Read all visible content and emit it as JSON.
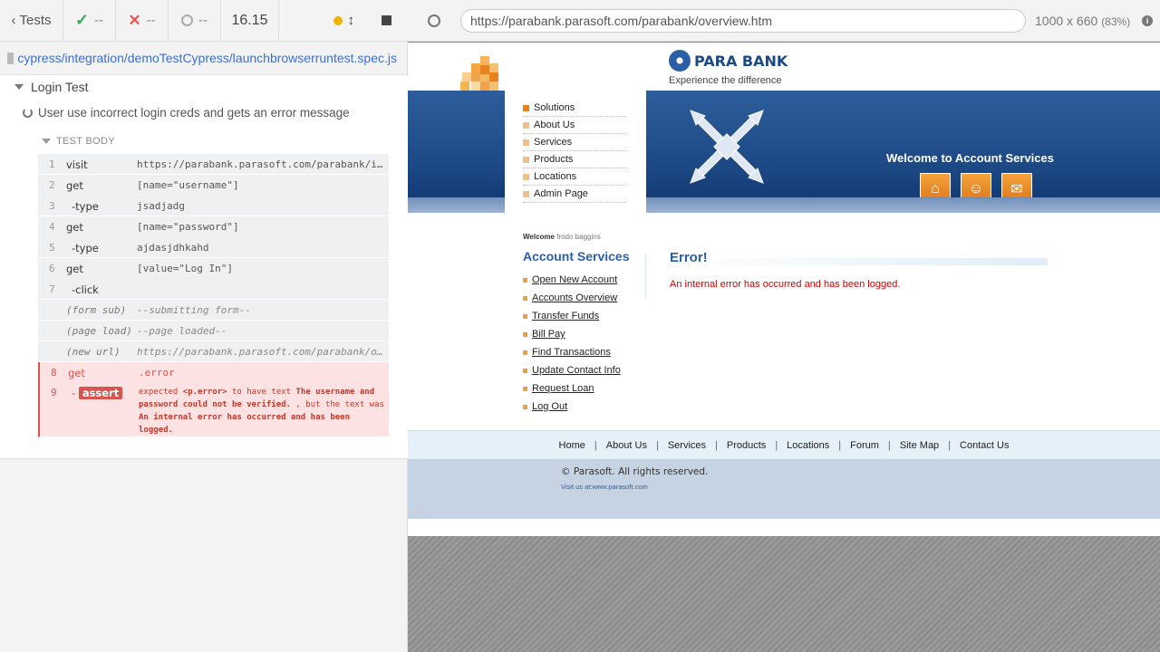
{
  "runner": {
    "tests_label": "Tests",
    "passed": "--",
    "failed": "--",
    "pending": "--",
    "duration": "16.15"
  },
  "spec": {
    "path": "cypress/integration/demoTestCypress/launchbrowserruntest.spec.js"
  },
  "suite": {
    "title": "Login Test",
    "test_title": "User use incorrect login creds and gets an error message",
    "body_label": "TEST BODY"
  },
  "commands": [
    {
      "num": "1",
      "name": "visit",
      "msg": "https://parabank.parasoft.com/parabank/index.htm"
    },
    {
      "num": "2",
      "name": "get",
      "msg": "[name=\"username\"]"
    },
    {
      "num": "3",
      "name": "-type",
      "msg": "jsadjadg"
    },
    {
      "num": "4",
      "name": "get",
      "msg": "[name=\"password\"]"
    },
    {
      "num": "5",
      "name": "-type",
      "msg": "ajdasjdhkahd"
    },
    {
      "num": "6",
      "name": "get",
      "msg": "[value=\"Log In\"]"
    },
    {
      "num": "7",
      "name": "-click",
      "msg": ""
    },
    {
      "num": "",
      "name": "(form sub)",
      "msg": "--submitting form--"
    },
    {
      "num": "",
      "name": "(page load)",
      "msg": "--page loaded--"
    },
    {
      "num": "",
      "name": "(new url)",
      "msg": "https://parabank.parasoft.com/parabank/overview.htm"
    },
    {
      "num": "8",
      "name": "get",
      "msg": ".error"
    }
  ],
  "assert": {
    "num": "9",
    "dash": "-",
    "label": "assert",
    "expected": "expected",
    "selector": "<p.error>",
    "to_have_text": "to have text",
    "expected_text": "The username and password could not be verified.",
    "but_the_text_was": ", but the text was",
    "actual_text": "An internal error has occurred and has been logged."
  },
  "browser": {
    "url": "https://parabank.parasoft.com/parabank/overview.htm",
    "viewport": "1000 x 660",
    "scale": "(83%)",
    "info": "i"
  },
  "parabank": {
    "brand": "PARA BANK",
    "tagline": "Experience the difference",
    "top_nav": [
      "Solutions",
      "About Us",
      "Services",
      "Products",
      "Locations",
      "Admin Page"
    ],
    "banner_title": "Welcome to Account Services",
    "welcome": "Welcome",
    "user": "frodo baggins",
    "account_services_title": "Account Services",
    "account_links": [
      "Open New Account",
      "Accounts Overview",
      "Transfer Funds",
      "Bill Pay",
      "Find Transactions",
      "Update Contact Info",
      "Request Loan",
      "Log Out"
    ],
    "error_title": "Error!",
    "error_message": "An internal error has occurred and has been logged.",
    "footer_links": [
      "Home",
      "About Us",
      "Services",
      "Products",
      "Locations",
      "Forum",
      "Site Map",
      "Contact Us"
    ],
    "copyright": "© Parasoft. All rights reserved.",
    "visit": "Visit us at:www.parasoft.com"
  },
  "icons": {
    "back": "chevron-left-icon",
    "passed": "check-icon",
    "failed": "x-icon",
    "pending": "circle-icon",
    "running": "dot-icon",
    "scroll": "up-down-arrow-icon",
    "stop": "stop-icon",
    "selector": "crosshair-icon",
    "home": "house-icon",
    "contact": "people-icon",
    "mail": "envelope-icon"
  },
  "colors": {
    "pass": "#3aa655",
    "fail": "#e05a5a",
    "link": "#3b6ed8",
    "running": "#f0b400",
    "error_bg": "#fde2e3",
    "parabank_blue": "#2a5fa6",
    "parabank_orange": "#e8821f"
  }
}
